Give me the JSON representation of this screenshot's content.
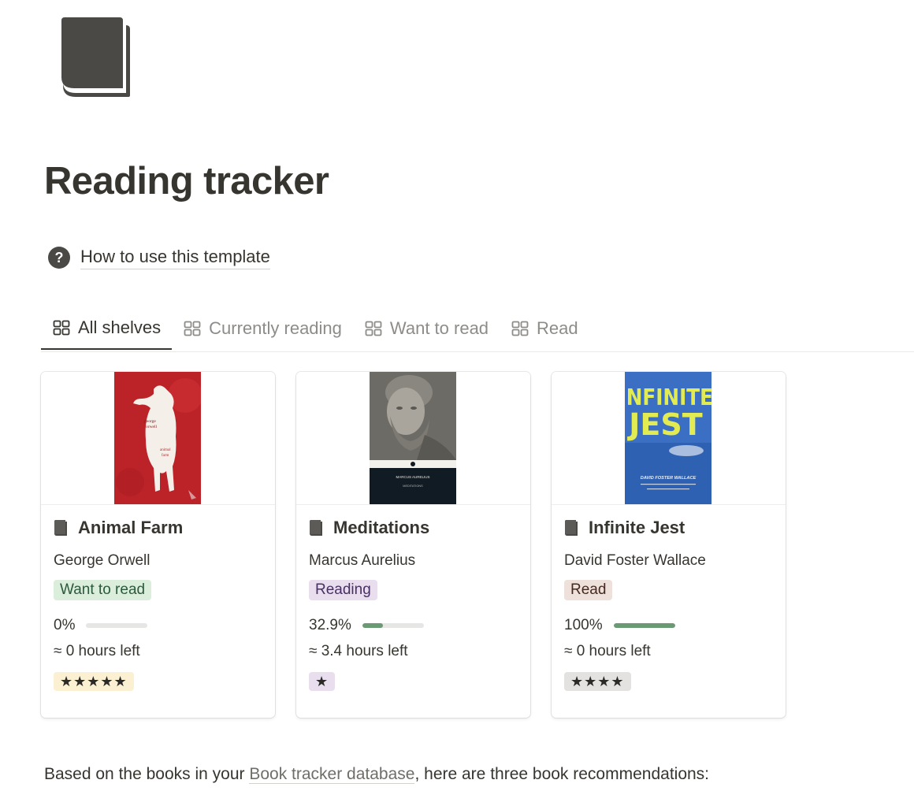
{
  "page": {
    "icon": "book-icon",
    "title": "Reading tracker"
  },
  "how_to": {
    "icon": "question-circle-icon",
    "label": "How to use this template"
  },
  "tabs": [
    {
      "label": "All shelves",
      "icon": "gallery-icon",
      "active": true
    },
    {
      "label": "Currently reading",
      "icon": "gallery-icon",
      "active": false
    },
    {
      "label": "Want to read",
      "icon": "gallery-icon",
      "active": false
    },
    {
      "label": "Read",
      "icon": "gallery-icon",
      "active": false
    }
  ],
  "cards": [
    {
      "title": "Animal Farm",
      "cover_text": [
        "george",
        "orwell",
        "animal",
        "farm"
      ],
      "author": "George Orwell",
      "status": "Want to read",
      "status_bg": "#dbeddb",
      "status_color": "#2b593f",
      "progress_label": "0%",
      "progress": 0,
      "hours_left": "≈ 0 hours left",
      "rating": "★★★★★",
      "rating_bg": "#fbf0d2"
    },
    {
      "title": "Meditations",
      "cover_text": [
        "MARCUS AURELIUS",
        "MEDITATIONS"
      ],
      "author": "Marcus Aurelius",
      "status": "Reading",
      "status_bg": "#e8deee",
      "status_color": "#492f64",
      "progress_label": "32.9%",
      "progress": 0.329,
      "hours_left": "≈ 3.4 hours left",
      "rating": "★",
      "rating_bg": "#e8deee"
    },
    {
      "title": "Infinite Jest",
      "cover_text": [
        "INFINITE",
        "JEST",
        "DAVID FOSTER WALLACE"
      ],
      "author": "David Foster Wallace",
      "status": "Read",
      "status_bg": "#eee0da",
      "status_color": "#44291f",
      "progress_label": "100%",
      "progress": 1,
      "hours_left": "≈ 0 hours left",
      "rating": "★★★★",
      "rating_bg": "#e3e2e0"
    }
  ],
  "footer": {
    "before": "Based on the books in your ",
    "link": "Book tracker database",
    "after": ", here are three book recommendations:"
  },
  "colors": {
    "text": "#37352f",
    "muted": "#8e8c88",
    "progress_fill": "#6a9a73",
    "progress_track": "#e6e6e4"
  }
}
